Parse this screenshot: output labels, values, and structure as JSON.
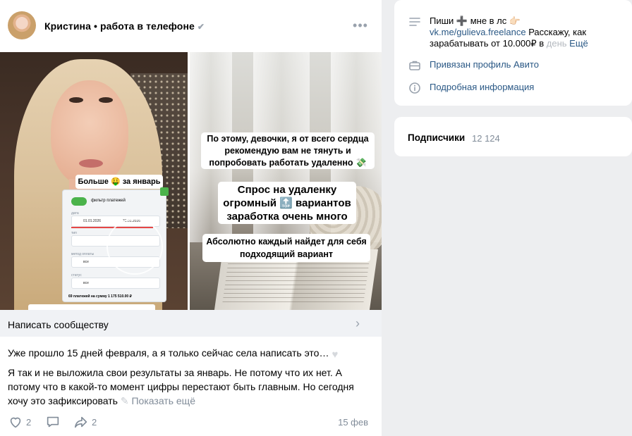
{
  "post": {
    "author": "Кристина",
    "author_sep": " • ",
    "author_tag": "работа в телефоне",
    "photo_left": {
      "sticker": "Больше 🤑 за январь 😅",
      "card_filter": "фильтр платежей",
      "card_date_label": "дата",
      "card_date_from": "01.01.2026",
      "card_date_to": "31.01.2026",
      "card_type_label": "тип",
      "card_method_label": "метод оплаты",
      "card_method_value": "все",
      "card_status_label": "статус",
      "card_status_value": "все",
      "card_total": "69 платежей на сумму 1 175 510.00 ₽"
    },
    "photo_right": {
      "caption1": "По этому, девочки, я от всего сердца рекомендую вам не тянуть и попробовать работать удаленно 💸",
      "caption2": "Спрос на удаленку огромный 🔝 вариантов заработка очень много",
      "caption3": "Абсолютно каждый найдет для себя подходящий вариант"
    },
    "write_label": "Написать сообществу",
    "text_line1": "Уже прошло 15 дней февраля, а я только сейчас села написать это…",
    "text_body": "Я так и не выложила свои результаты за январь. Не потому что их нет. А потому что в какой-то момент цифры перестают быть главным. Но сегодня хочу это зафиксировать",
    "show_more": "Показать ещё",
    "likes": "2",
    "shares": "2",
    "date": "15 фев"
  },
  "info": {
    "line1": "Пиши ➕ мне в лс 👉🏻",
    "link": "vk.me/gulieva.freelance",
    "line1_rest": " Расскажу, как зарабатывать от 10.000₽ в ",
    "faded": "день",
    "more": "Ещё",
    "avito": "Привязан профиль Авито",
    "details": "Подробная информация"
  },
  "subs": {
    "label": "Подписчики",
    "count": "12 124"
  },
  "colors": {
    "link": "#2a5885",
    "muted": "#818c99",
    "icon": "#99a2ad",
    "background": "#edeef0"
  }
}
